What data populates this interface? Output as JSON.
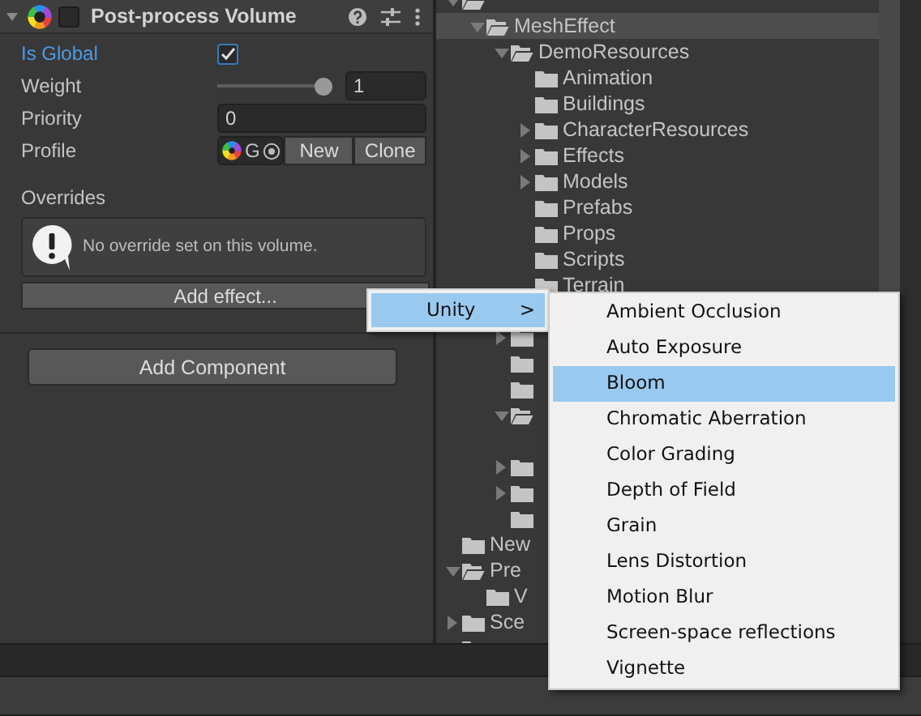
{
  "inspector": {
    "component": {
      "title": "Post-process Volume",
      "expanded": true,
      "enabled": false
    },
    "fields": [
      {
        "kind": "checkbox",
        "label": "Is Global",
        "checked": true,
        "highlighted": true
      },
      {
        "kind": "slider",
        "label": "Weight",
        "level": 1,
        "value": "1"
      },
      {
        "kind": "number",
        "label": "Priority",
        "value": "0"
      },
      {
        "kind": "object",
        "label": "Profile",
        "value": "G",
        "buttons": [
          "New",
          "Clone"
        ]
      }
    ],
    "overrides": {
      "title": "Overrides",
      "message": "No override set on this volume.",
      "button": "Add effect..."
    },
    "add_component": "Add Component"
  },
  "project_tree": [
    {
      "kind": "folder",
      "selected": false,
      "expanded": true,
      "children": [
        {
          "kind": "folder",
          "label": "MeshEffect",
          "selected": true,
          "expanded": true,
          "children": [
            {
              "kind": "folder",
              "label": "DemoResources",
              "selected": false,
              "expanded": true,
              "children": [
                {
                  "kind": "folder",
                  "label": "Animation",
                  "selected": false
                },
                {
                  "kind": "folder",
                  "label": "Buildings",
                  "selected": false
                },
                {
                  "kind": "folder",
                  "label": "CharacterResources",
                  "selected": false,
                  "expanded": false
                },
                {
                  "kind": "folder",
                  "label": "Effects",
                  "selected": false,
                  "expanded": false
                },
                {
                  "kind": "folder",
                  "label": "Models",
                  "selected": false,
                  "expanded": false
                },
                {
                  "kind": "folder",
                  "label": "Prefabs",
                  "selected": false
                },
                {
                  "kind": "folder",
                  "label": "Props",
                  "selected": false
                },
                {
                  "kind": "folder",
                  "label": "Scripts",
                  "selected": false
                },
                {
                  "kind": "folder",
                  "label": "Terrain",
                  "selected": false
                },
                {
                  "kind": "blank"
                }
              ]
            },
            {
              "kind": "folder",
              "selected": false,
              "expanded": false
            },
            {
              "kind": "folder",
              "selected": false
            },
            {
              "kind": "folder",
              "selected": false
            },
            {
              "kind": "folder",
              "selected": false,
              "expanded": true,
              "children": [
                {
                  "kind": "blank"
                }
              ]
            },
            {
              "kind": "folder",
              "selected": false,
              "expanded": false
            },
            {
              "kind": "folder",
              "selected": false,
              "expanded": false
            },
            {
              "kind": "folder",
              "selected": false
            }
          ]
        }
      ]
    },
    {
      "kind": "folder",
      "label": "New",
      "selected": false
    },
    {
      "kind": "folder",
      "label": "Pre",
      "selected": false,
      "expanded": true,
      "children": [
        {
          "kind": "folder",
          "label": "V",
          "selected": false
        }
      ]
    },
    {
      "kind": "folder",
      "label": "Sce",
      "selected": false,
      "expanded": false
    },
    {
      "kind": "folder",
      "selected": false
    }
  ],
  "context_menu": {
    "items": [
      {
        "label": "Unity",
        "arrow": ">",
        "selected": true
      }
    ]
  },
  "submenu": {
    "items": [
      {
        "label": "Ambient Occlusion",
        "selected": false
      },
      {
        "label": "Auto Exposure",
        "selected": false
      },
      {
        "label": "Bloom",
        "selected": true
      },
      {
        "label": "Chromatic Aberration",
        "selected": false
      },
      {
        "label": "Color Grading",
        "selected": false
      },
      {
        "label": "Depth of Field",
        "selected": false
      },
      {
        "label": "Grain",
        "selected": false
      },
      {
        "label": "Lens Distortion",
        "selected": false
      },
      {
        "label": "Motion Blur",
        "selected": false
      },
      {
        "label": "Screen-space reflections",
        "selected": false
      },
      {
        "label": "Vignette",
        "selected": false
      }
    ]
  }
}
